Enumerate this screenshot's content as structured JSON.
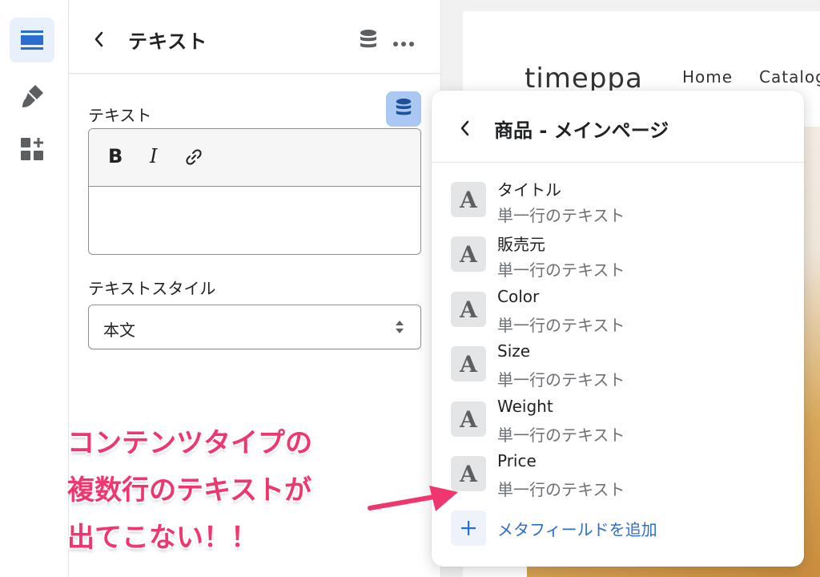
{
  "rail": {
    "items": [
      {
        "icon": "sections-icon",
        "active": true
      },
      {
        "icon": "theme-brush-icon",
        "active": false
      },
      {
        "icon": "apps-add-icon",
        "active": false
      }
    ]
  },
  "panel": {
    "title": "テキスト",
    "text_field_label": "テキスト",
    "editor": {
      "bold_label": "B",
      "italic_label": "I",
      "value": ""
    },
    "style_label": "テキストスタイル",
    "style_value": "本文"
  },
  "preview": {
    "logo": "timeppa",
    "nav": [
      "Home",
      "Catalog"
    ]
  },
  "popover": {
    "title": "商品 - メインページ",
    "items": [
      {
        "name": "タイトル",
        "type": "単一行のテキスト",
        "icon_letter": "A"
      },
      {
        "name": "販売元",
        "type": "単一行のテキスト",
        "icon_letter": "A"
      },
      {
        "name": "Color",
        "type": "単一行のテキスト",
        "icon_letter": "A"
      },
      {
        "name": "Size",
        "type": "単一行のテキスト",
        "icon_letter": "A"
      },
      {
        "name": "Weight",
        "type": "単一行のテキスト",
        "icon_letter": "A"
      },
      {
        "name": "Price",
        "type": "単一行のテキスト",
        "icon_letter": "A"
      }
    ],
    "add_label": "メタフィールドを追加"
  },
  "annotation": {
    "lines": [
      "コンテンツタイプの",
      "複数行のテキストが",
      "出てこない！！"
    ],
    "color": "#f0366f"
  },
  "colors": {
    "accent": "#2c6ecb",
    "active_rail": "#e8f0fb",
    "source_button": "#a9c8f3"
  }
}
